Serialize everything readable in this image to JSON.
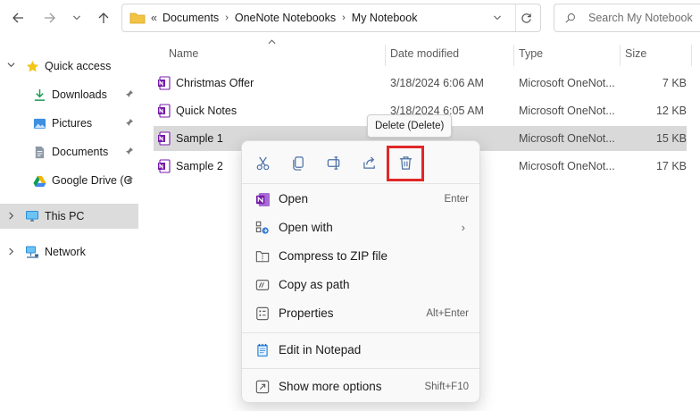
{
  "address": {
    "overflow_glyph": "«",
    "breadcrumbs": [
      "Documents",
      "OneNote Notebooks",
      "My Notebook"
    ]
  },
  "search": {
    "placeholder": "Search My Notebook"
  },
  "sidebar": {
    "items": [
      {
        "label": "Quick access",
        "icon": "star-icon"
      },
      {
        "label": "Downloads",
        "icon": "download-icon"
      },
      {
        "label": "Pictures",
        "icon": "pictures-icon"
      },
      {
        "label": "Documents",
        "icon": "documents-icon"
      },
      {
        "label": "Google Drive (G",
        "icon": "google-drive-icon"
      },
      {
        "label": "This PC",
        "icon": "monitor-icon"
      },
      {
        "label": "Network",
        "icon": "network-icon"
      }
    ]
  },
  "columns": {
    "name": "Name",
    "date": "Date modified",
    "type": "Type",
    "size": "Size"
  },
  "files": [
    {
      "name": "Christmas Offer",
      "date": "3/18/2024 6:06 AM",
      "type": "Microsoft OneNot...",
      "size": "7 KB"
    },
    {
      "name": "Quick Notes",
      "date": "3/18/2024 6:05 AM",
      "type": "Microsoft OneNot...",
      "size": "12 KB"
    },
    {
      "name": "Sample 1",
      "date": "",
      "type": "Microsoft OneNot...",
      "size": "15 KB"
    },
    {
      "name": "Sample 2",
      "date": "",
      "type": "Microsoft OneNot...",
      "size": "17 KB"
    }
  ],
  "tooltip": "Delete (Delete)",
  "context_menu": {
    "quick_actions": [
      "cut-icon",
      "copy-icon",
      "rename-icon",
      "share-icon",
      "delete-icon"
    ],
    "items": [
      {
        "label": "Open",
        "shortcut": "Enter",
        "icon": "onenote-icon"
      },
      {
        "label": "Open with",
        "shortcut": "",
        "icon": "open-with-icon"
      },
      {
        "label": "Compress to ZIP file",
        "shortcut": "",
        "icon": "zip-icon"
      },
      {
        "label": "Copy as path",
        "shortcut": "",
        "icon": "copy-path-icon"
      },
      {
        "label": "Properties",
        "shortcut": "Alt+Enter",
        "icon": "properties-icon"
      },
      {
        "label": "Edit in Notepad",
        "shortcut": "",
        "icon": "notepad-icon"
      },
      {
        "label": "Show more options",
        "shortcut": "Shift+F10",
        "icon": "more-options-icon"
      }
    ],
    "submenu_arrow": "›"
  },
  "colors": {
    "selected_row": "#d9d9d9",
    "highlight_box": "#e02828",
    "onenote_purple": "#7719aa"
  }
}
